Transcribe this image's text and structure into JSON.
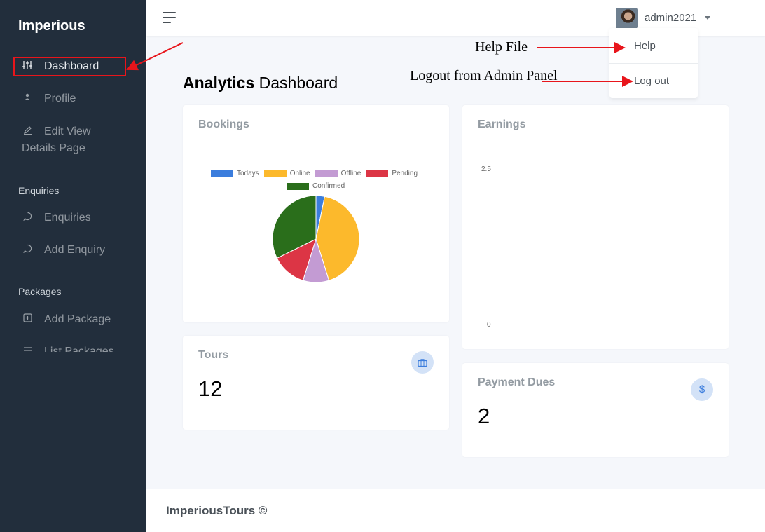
{
  "sidebar": {
    "brand": "Imperious",
    "items": [
      {
        "label": "Dashboard",
        "icon": "sliders-icon"
      },
      {
        "label": "Profile",
        "icon": "user-icon"
      },
      {
        "label_line1": "Edit View",
        "label_line2": "Details Page",
        "icon": "edit-icon"
      },
      {
        "label": "Enquiries",
        "icon": "message-circle-icon"
      },
      {
        "label": "Add Enquiry",
        "icon": "message-circle-icon"
      },
      {
        "label": "Add Package",
        "icon": "plus-square-icon"
      },
      {
        "label": "List Packages",
        "icon": "list-icon"
      }
    ],
    "sections": {
      "enquiries": "Enquiries",
      "packages": "Packages"
    }
  },
  "topbar": {
    "username": "admin2021"
  },
  "dropdown": {
    "help": "Help",
    "logout": "Log out"
  },
  "page": {
    "title_bold": "Analytics",
    "title_rest": "Dashboard"
  },
  "cards": {
    "bookings": {
      "title": "Bookings"
    },
    "earnings": {
      "title": "Earnings"
    },
    "tours": {
      "title": "Tours",
      "value": "12",
      "icon": "briefcase-icon"
    },
    "payment_dues": {
      "title": "Payment Dues",
      "value": "2",
      "icon": "dollar-icon"
    }
  },
  "chart_data": [
    {
      "type": "pie",
      "categories": [
        "Todays",
        "Online",
        "Offline",
        "Pending",
        "Confirmed"
      ],
      "values": [
        1,
        13,
        3,
        4,
        10
      ],
      "colors": [
        "#3b7ddd",
        "#fcb92c",
        "#c39bd3",
        "#dc3545",
        "#2a6e1b"
      ],
      "legend": "top"
    },
    {
      "type": "line",
      "yticks": [
        "2.5",
        "0"
      ],
      "ylim": [
        0,
        2.5
      ],
      "series": []
    }
  ],
  "footer": {
    "text": "ImperiousTours ©"
  },
  "annotations": {
    "help": "Help File",
    "logout": "Logout from Admin Panel"
  }
}
